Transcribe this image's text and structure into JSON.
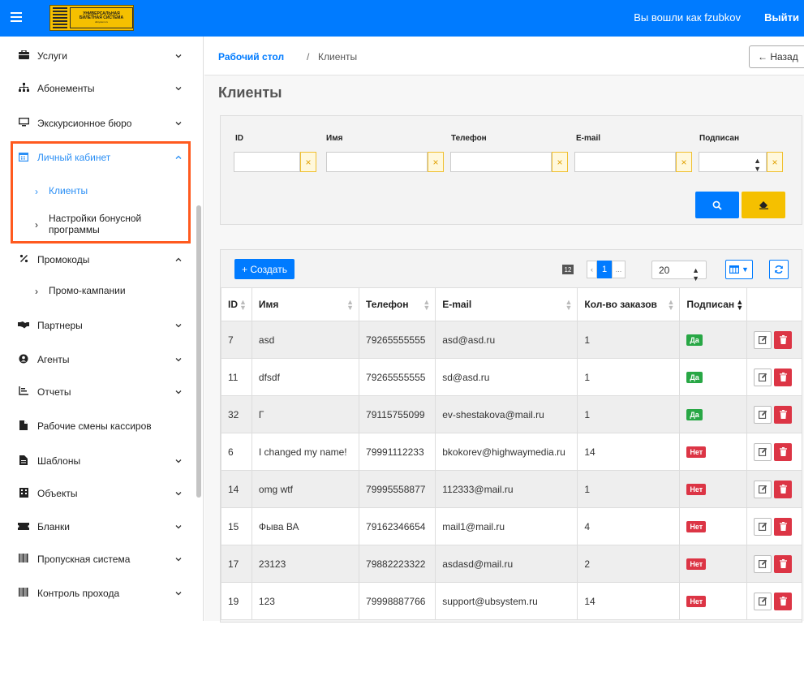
{
  "topbar": {
    "logo_line1": "УНИВЕРСАЛЬНАЯ",
    "logo_line2": "БИЛЕТНАЯ СИСТЕМА",
    "logo_line3": "ubsystem.ru",
    "logged_in_text": "Вы вошли как fzubkov",
    "logout_label": "Выйти"
  },
  "sidebar": {
    "items": [
      {
        "label": "Услуги"
      },
      {
        "label": "Абонементы"
      },
      {
        "label": "Экскурсионное бюро"
      },
      {
        "label": "Личный кабинет"
      },
      {
        "label": "Клиенты"
      },
      {
        "label": "Настройки бонусной программы"
      },
      {
        "label": "Промокоды"
      },
      {
        "label": "Промо-кампании"
      },
      {
        "label": "Партнеры"
      },
      {
        "label": "Агенты"
      },
      {
        "label": "Отчеты"
      },
      {
        "label": "Рабочие смены кассиров"
      },
      {
        "label": "Шаблоны"
      },
      {
        "label": "Объекты"
      },
      {
        "label": "Бланки"
      },
      {
        "label": "Пропускная система"
      },
      {
        "label": "Контроль прохода"
      }
    ]
  },
  "breadcrumb": {
    "home": "Рабочий стол",
    "separator": "/",
    "current": "Клиенты",
    "back_label": "← Назад"
  },
  "page": {
    "title": "Клиенты"
  },
  "filters": {
    "id_label": "ID",
    "name_label": "Имя",
    "phone_label": "Телефон",
    "email_label": "E-mail",
    "subscribed_label": "Подписан",
    "clear_symbol": "×",
    "id_value": "",
    "name_value": "",
    "phone_value": "",
    "email_value": "",
    "subscribed_value": ""
  },
  "toolbar": {
    "create_label": "+ Создать",
    "count": "12",
    "prev": "‹",
    "page": "1",
    "next": "...",
    "per_page": "20"
  },
  "table": {
    "headers": [
      "ID",
      "Имя",
      "Телефон",
      "E-mail",
      "Кол-во заказов",
      "Подписан"
    ],
    "rows": [
      {
        "id": "7",
        "name": "asd",
        "phone": "79265555555",
        "email": "asd@asd.ru",
        "orders": "1",
        "subscribed": "Да"
      },
      {
        "id": "11",
        "name": "dfsdf",
        "phone": "79265555555",
        "email": "sd@asd.ru",
        "orders": "1",
        "subscribed": "Да"
      },
      {
        "id": "32",
        "name": "Г",
        "phone": "79115755099",
        "email": "ev-shestakova@mail.ru",
        "orders": "1",
        "subscribed": "Да"
      },
      {
        "id": "6",
        "name": "I changed my name!",
        "phone": "79991112233",
        "email": "bkokorev@highwaymedia.ru",
        "orders": "14",
        "subscribed": "Нет"
      },
      {
        "id": "14",
        "name": "omg wtf",
        "phone": "79995558877",
        "email": "112333@mail.ru",
        "orders": "1",
        "subscribed": "Нет"
      },
      {
        "id": "15",
        "name": "Фыва ВА",
        "phone": "79162346654",
        "email": "mail1@mail.ru",
        "orders": "4",
        "subscribed": "Нет"
      },
      {
        "id": "17",
        "name": "23123",
        "phone": "79882223322",
        "email": "asdasd@mail.ru",
        "orders": "2",
        "subscribed": "Нет"
      },
      {
        "id": "19",
        "name": "123",
        "phone": "79998887766",
        "email": "support@ubsystem.ru",
        "orders": "14",
        "subscribed": "Нет"
      }
    ]
  },
  "colors": {
    "primary": "#007bff",
    "warning": "#f5c000",
    "success": "#28a745",
    "danger": "#dc3545",
    "highlight_box": "#ff5a1f",
    "active_link": "#2b8ff5"
  }
}
